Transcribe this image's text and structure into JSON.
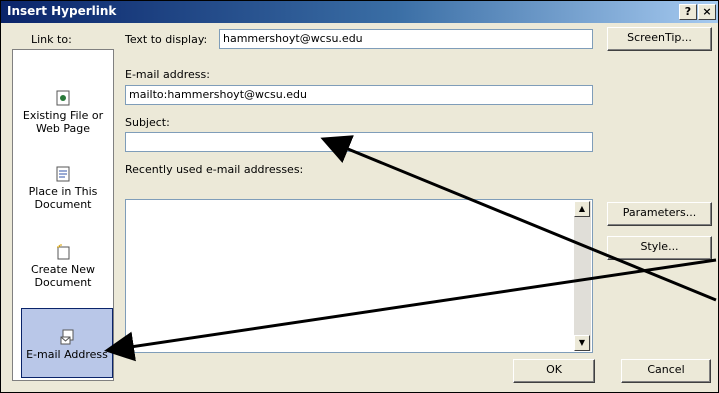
{
  "window": {
    "title": "Insert Hyperlink",
    "help": "?",
    "close": "×"
  },
  "link_to_label": "Link to:",
  "text_to_display": {
    "label": "Text to display:",
    "value": "hammershoyt@wcsu.edu"
  },
  "screentip_label": "ScreenTip...",
  "sidebar": {
    "items": [
      {
        "label_line1": "Existing File or",
        "label_line2": "Web Page"
      },
      {
        "label_line1": "Place in This",
        "label_line2": "Document"
      },
      {
        "label_line1": "Create New",
        "label_line2": "Document"
      },
      {
        "label_line1": "E-mail Address",
        "label_line2": ""
      }
    ]
  },
  "email_address": {
    "label": "E-mail address:",
    "value": "mailto:hammershoyt@wcsu.edu"
  },
  "subject": {
    "label": "Subject:",
    "value": ""
  },
  "recent": {
    "label": "Recently used e-mail addresses:"
  },
  "buttons": {
    "parameters": "Parameters...",
    "style": "Style...",
    "ok": "OK",
    "cancel": "Cancel"
  },
  "colors": {
    "title_start": "#0a246a",
    "title_end": "#a6caf0",
    "selection": "#b9c7e8",
    "dialog": "#ece9d8"
  },
  "icons": [
    "page-icon",
    "bookmark-icon",
    "new-document-icon",
    "email-icon"
  ]
}
